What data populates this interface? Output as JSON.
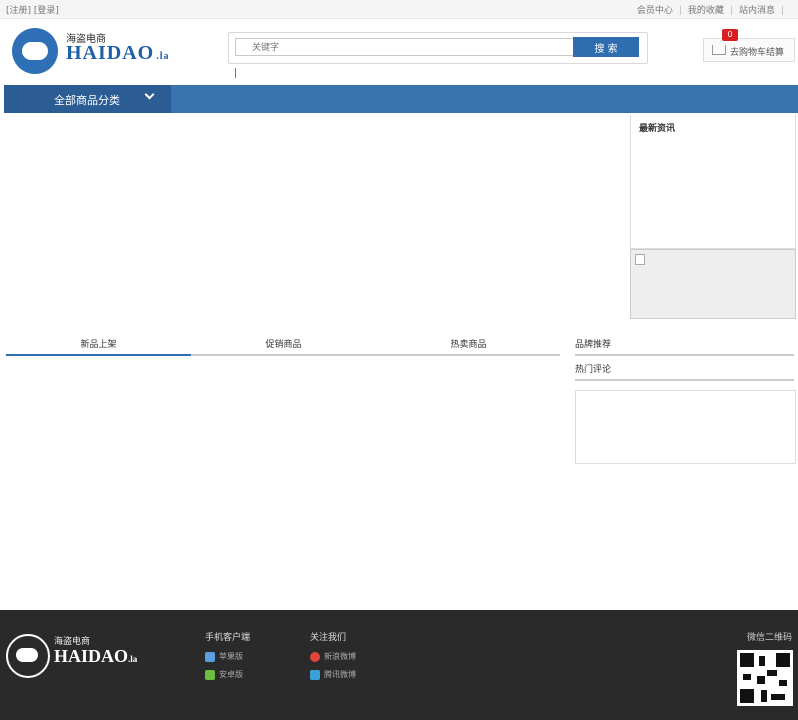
{
  "topbar": {
    "left_text": "[注册] [登录]",
    "member_center": "会员中心",
    "my_favorites": "我的收藏",
    "site_messages": "站内消息"
  },
  "logo": {
    "cn": "海盗电商",
    "en": "HAIDAO",
    "tld": ".la"
  },
  "search": {
    "placeholder": "关键字",
    "button": "搜 索"
  },
  "cart": {
    "count": "0",
    "label": "去购物车结算"
  },
  "nav": {
    "all_categories": "全部商品分类"
  },
  "news": {
    "title": "最新资讯"
  },
  "tabs": [
    "新品上架",
    "促销商品",
    "热卖商品"
  ],
  "side_tabs": [
    "品牌推荐",
    "热门评论"
  ],
  "footer": {
    "logo_cn": "海盗电商",
    "logo_en": "HAIDAO",
    "logo_tld": ".la",
    "mobile_title": "手机客户端",
    "ios": "苹果版",
    "android": "安卓版",
    "follow_title": "关注我们",
    "weibo_sina": "新浪微博",
    "weibo_tencent": "腾讯微博",
    "qr_title": "微信二维码"
  },
  "colors": {
    "brand_blue": "#3b73b1",
    "nav_dark": "#2c5c94",
    "footer_bg": "#2a2a2a",
    "badge_red": "#d81e1e"
  }
}
